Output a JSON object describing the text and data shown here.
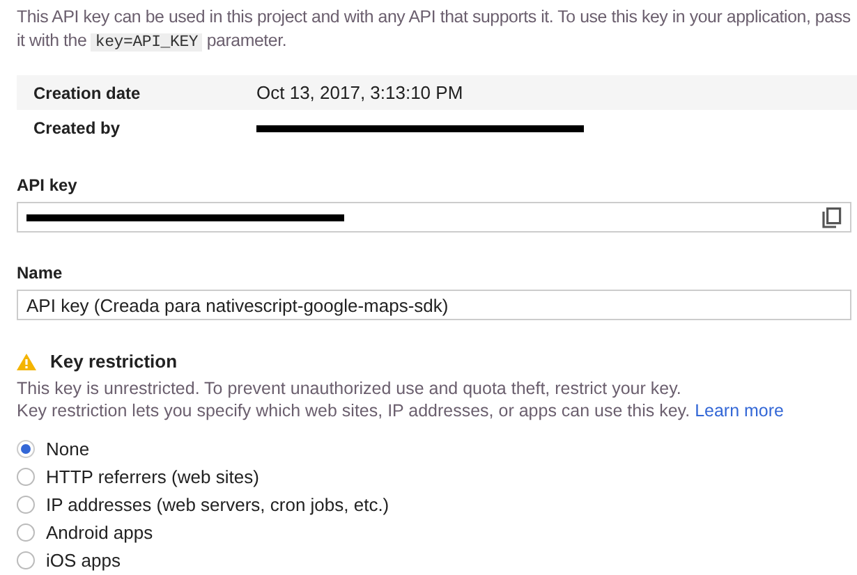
{
  "intro": [
    {
      "kind": "text",
      "text": "This API key can be used in this project and with any API that supports it. To use this key in your application, pass it with the "
    },
    {
      "kind": "code",
      "text": "key=API_KEY"
    },
    {
      "kind": "text",
      "text": " parameter."
    }
  ],
  "details": [
    {
      "label": "Creation date",
      "value": "Oct 13, 2017, 3:13:10 PM",
      "redacted": false
    },
    {
      "label": "Created by",
      "redacted": true
    }
  ],
  "api_key": {
    "label": "API key",
    "redacted": true
  },
  "name": {
    "label": "Name",
    "value": "API key (Creada para nativescript-google-maps-sdk)"
  },
  "restriction": {
    "title": "Key restriction",
    "warning": true,
    "lines": [
      "This key is unrestricted. To prevent unauthorized use and quota theft, restrict your key.",
      "Key restriction lets you specify which web sites, IP addresses, or apps can use this key."
    ],
    "link": "Learn more",
    "options": [
      {
        "label": "None",
        "selected": true
      },
      {
        "label": "HTTP referrers (web sites)",
        "selected": false
      },
      {
        "label": "IP addresses (web servers, cron jobs, etc.)",
        "selected": false
      },
      {
        "label": "Android apps",
        "selected": false
      },
      {
        "label": "iOS apps",
        "selected": false
      }
    ]
  }
}
